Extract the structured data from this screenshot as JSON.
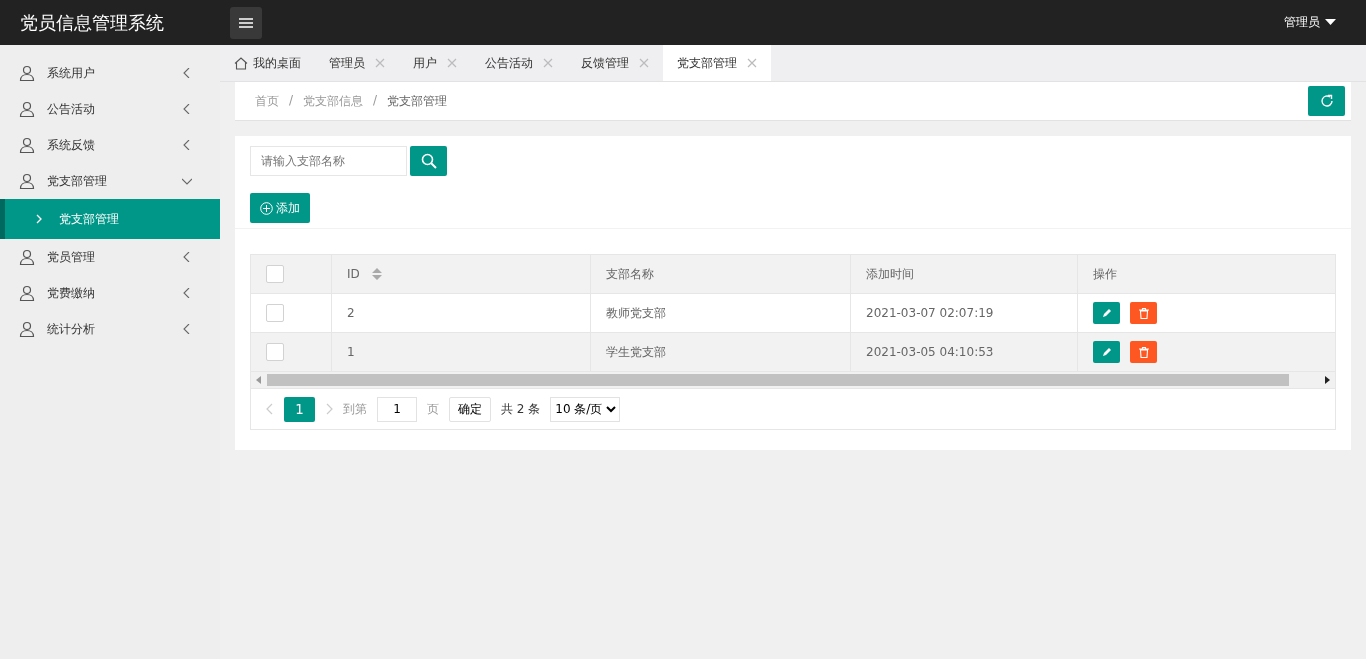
{
  "header": {
    "title": "党员信息管理系统",
    "user": "管理员"
  },
  "sidebar": {
    "items": [
      {
        "label": "系统用户",
        "expanded": false
      },
      {
        "label": "公告活动",
        "expanded": false
      },
      {
        "label": "系统反馈",
        "expanded": false
      },
      {
        "label": "党支部管理",
        "expanded": true,
        "children": [
          {
            "label": "党支部管理",
            "selected": true
          }
        ]
      },
      {
        "label": "党员管理",
        "expanded": false
      },
      {
        "label": "党费缴纳",
        "expanded": false
      },
      {
        "label": "统计分析",
        "expanded": false
      }
    ]
  },
  "tabs": [
    {
      "label": "我的桌面",
      "kind": "home",
      "selected": false
    },
    {
      "label": "管理员",
      "kind": "closable",
      "selected": false
    },
    {
      "label": "用户",
      "kind": "closable",
      "selected": false
    },
    {
      "label": "公告活动",
      "kind": "closable",
      "selected": false
    },
    {
      "label": "反馈管理",
      "kind": "closable",
      "selected": false
    },
    {
      "label": "党支部管理",
      "kind": "closable",
      "selected": true
    }
  ],
  "breadcrumb": [
    {
      "label": "首页"
    },
    {
      "separator": "/",
      "label": "党支部信息"
    },
    {
      "separator": "/",
      "label": "党支部管理"
    }
  ],
  "search": {
    "placeholder": "请输入支部名称"
  },
  "add_button": "添加",
  "table": {
    "header_checked": false,
    "columns": [
      {
        "kind": "check"
      },
      {
        "label": "ID",
        "kind": "sort"
      },
      {
        "label": "支部名称",
        "kind": "text"
      },
      {
        "label": "添加时间",
        "kind": "text"
      },
      {
        "label": "操作",
        "kind": "text"
      }
    ],
    "rows": [
      {
        "checked": false,
        "id": "2",
        "name": "教师党支部",
        "time": "2021-03-07 02:07:19"
      },
      {
        "checked": false,
        "id": "1",
        "name": "学生党支部",
        "time": "2021-03-05 04:10:53"
      }
    ]
  },
  "pagination": {
    "current": "1",
    "goto_label": "到第",
    "goto_value": "1",
    "page_label": "页",
    "confirm": "确定",
    "total": "共 2 条",
    "page_size": "10 条/页"
  }
}
